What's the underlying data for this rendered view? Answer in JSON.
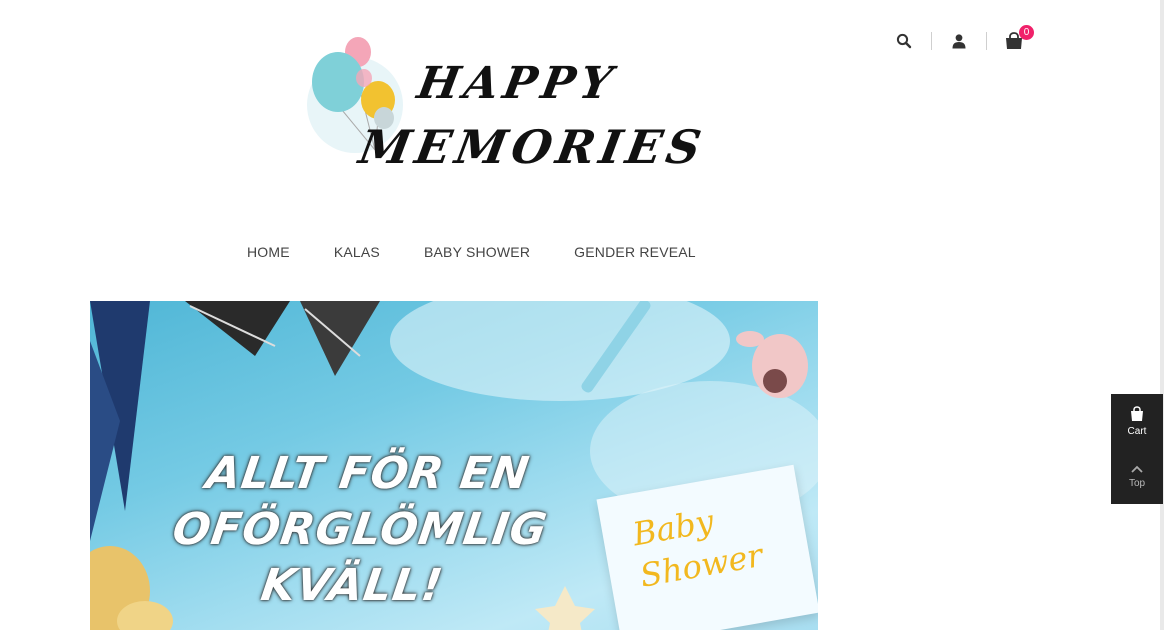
{
  "header": {
    "cart_count": "0",
    "icons": [
      "search-icon",
      "user-icon",
      "cart-icon"
    ]
  },
  "logo": {
    "line1": "HAPPY",
    "line2": "MEMORIES",
    "balloon_colors": [
      "#f4a6b8",
      "#7fd0d8",
      "#f2c230",
      "#bfe5ef"
    ]
  },
  "nav": {
    "items": [
      {
        "label": "HOME"
      },
      {
        "label": "KALAS"
      },
      {
        "label": "BABY SHOWER"
      },
      {
        "label": "GENDER REVEAL"
      }
    ]
  },
  "hero": {
    "lines": [
      "ALLT FÖR EN",
      "OFÖRGLÖMLIG",
      "KVÄLL!"
    ],
    "card_text_1": "Baby",
    "card_text_2": "Shower"
  },
  "side_widget": {
    "cart_label": "Cart",
    "top_label": "Top"
  },
  "colors": {
    "accent": "#f0216a",
    "widget_bg": "#222222"
  }
}
